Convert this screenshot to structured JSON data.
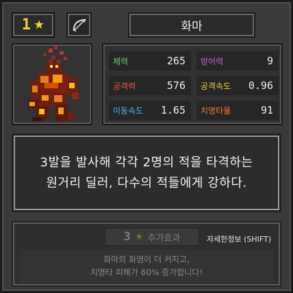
{
  "header": {
    "level": "1",
    "level_star": "★",
    "weapon_icon": "bow-icon",
    "unit_name": "화마"
  },
  "portrait": {
    "icon": "fire-demon-sprite"
  },
  "stats": [
    {
      "label": "체력",
      "value": "265",
      "color": "#5ed36a"
    },
    {
      "label": "방어력",
      "value": "9",
      "color": "#c268d8"
    },
    {
      "label": "공격력",
      "value": "576",
      "color": "#ec5a4c"
    },
    {
      "label": "공격속도",
      "value": "0.96",
      "color": "#e8d04a"
    },
    {
      "label": "이동속도",
      "value": "1.65",
      "color": "#4fb6e6"
    },
    {
      "label": "치명타율",
      "value": "91",
      "color": "#ef7c38"
    }
  ],
  "description": {
    "line1": "3발을 발사해 각각 2명의 적을 타격하는",
    "line2": "원거리 딜러, 다수의 적들에게 강하다."
  },
  "bonus": {
    "stars": "3",
    "star_icon": "★",
    "label": "추가효과",
    "detail_hint": "자세한정보 (SHIFT)",
    "line1": "화마의 화염이 더 커지고,",
    "line2": "치명타 피해가 60% 증가합니다!"
  },
  "colors": {
    "gold": "#f2d22b",
    "panel": "#3a3a3a"
  }
}
